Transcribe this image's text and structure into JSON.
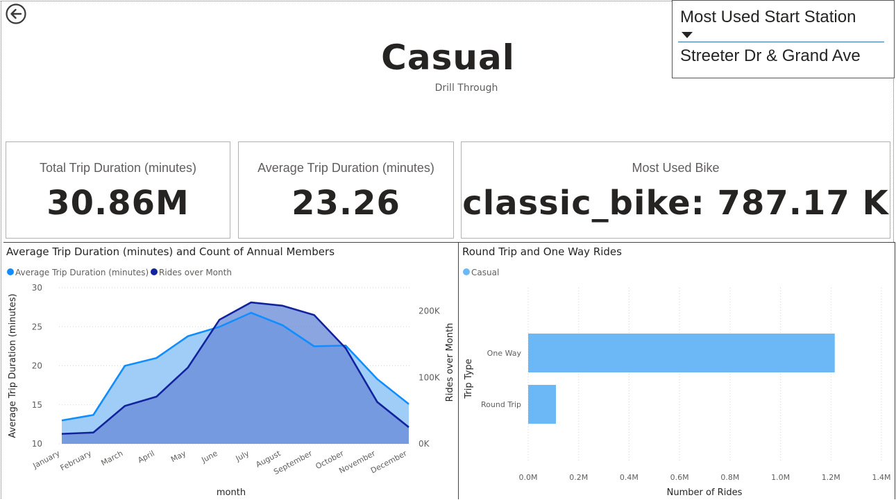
{
  "header": {
    "title": "Casual",
    "subtitle": "Drill Through",
    "back_icon": "back-arrow-icon"
  },
  "slicer": {
    "label": "Most Used Start Station",
    "value": "Streeter Dr & Grand Ave",
    "caret_icon": "caret-down-icon"
  },
  "cards": [
    {
      "label": "Total Trip Duration (minutes)",
      "value": "30.86M"
    },
    {
      "label": "Average Trip Duration (minutes)",
      "value": "23.26"
    },
    {
      "label": "Most Used Bike",
      "value": "classic_bike: 787.17 K"
    }
  ],
  "chart_data": [
    {
      "type": "area",
      "title": "Average Trip Duration (minutes) and Count of Annual Members",
      "xlabel": "month",
      "ylabel": "Average Trip Duration (minutes)",
      "y2label": "Rides over Month",
      "categories": [
        "January",
        "February",
        "March",
        "April",
        "May",
        "June",
        "July",
        "August",
        "September",
        "October",
        "November",
        "December"
      ],
      "ylim": [
        10,
        30
      ],
      "yticks": [
        "10",
        "15",
        "20",
        "25",
        "30"
      ],
      "y2lim": [
        0,
        235000
      ],
      "y2ticks": [
        {
          "v": 0,
          "label": "0K"
        },
        {
          "v": 100000,
          "label": "100K"
        },
        {
          "v": 200000,
          "label": "200K"
        }
      ],
      "series": [
        {
          "name": "Average Trip Duration (minutes)",
          "axis": "left",
          "color": "#118DFF",
          "fill": "#9fcdf7",
          "values": [
            13.0,
            13.7,
            20.0,
            21.0,
            23.8,
            25.0,
            26.8,
            25.2,
            22.5,
            22.6,
            18.3,
            15.1
          ]
        },
        {
          "name": "Rides over Month",
          "axis": "right",
          "color": "#12239E",
          "fill": "#6a8cd8",
          "values": [
            15000,
            17000,
            57000,
            71000,
            115000,
            187000,
            213000,
            208000,
            194000,
            144000,
            63000,
            25000
          ]
        }
      ],
      "legend": "top-left",
      "grid": true
    },
    {
      "type": "bar",
      "orientation": "horizontal",
      "title": "Round Trip and One Way Rides",
      "xlabel": "Number of Rides",
      "ylabel": "Trip Type",
      "categories": [
        "One Way",
        "Round Trip"
      ],
      "series": [
        {
          "name": "Casual",
          "color": "#6CB8F6",
          "values": [
            1215000,
            110000
          ]
        }
      ],
      "xlim": [
        0,
        1400000
      ],
      "xticks": [
        {
          "v": 0,
          "label": "0.0M"
        },
        {
          "v": 200000,
          "label": "0.2M"
        },
        {
          "v": 400000,
          "label": "0.4M"
        },
        {
          "v": 600000,
          "label": "0.6M"
        },
        {
          "v": 800000,
          "label": "0.8M"
        },
        {
          "v": 1000000,
          "label": "1.0M"
        },
        {
          "v": 1200000,
          "label": "1.2M"
        },
        {
          "v": 1400000,
          "label": "1.4M"
        }
      ],
      "legend": "top-left",
      "grid": true
    }
  ]
}
